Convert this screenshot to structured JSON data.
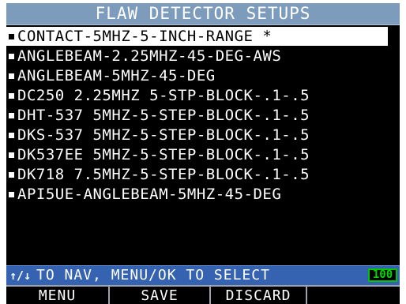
{
  "title": "FLAW DETECTOR SETUPS",
  "setups": [
    {
      "label": "CONTACT-5MHZ-5-INCH-RANGE  *",
      "selected": true
    },
    {
      "label": "ANGLEBEAM-2.25MHZ-45-DEG-AWS",
      "selected": false
    },
    {
      "label": "ANGLEBEAM-5MHZ-45-DEG",
      "selected": false
    },
    {
      "label": "DC250 2.25MHZ 5-STP-BLOCK-.1-.5",
      "selected": false
    },
    {
      "label": "DHT-537 5MHZ-5-STEP-BLOCK-.1-.5",
      "selected": false
    },
    {
      "label": "DKS-537 5MHZ-5-STEP-BLOCK-.1-.5",
      "selected": false
    },
    {
      "label": "DK537EE 5MHZ-5-STEP-BLOCK-.1-.5",
      "selected": false
    },
    {
      "label": "DK718 7.5MHZ-5-STEP-BLOCK-.1-.5",
      "selected": false
    },
    {
      "label": "API5UE-ANGLEBEAM-5MHZ-45-DEG",
      "selected": false
    }
  ],
  "status": {
    "nav_arrows": "↑/↓",
    "text": "TO NAV, MENU/OK TO SELECT",
    "battery": "100"
  },
  "softkeys": {
    "menu": "MENU",
    "save": "SAVE",
    "discard": "DISCARD",
    "blank": ""
  },
  "colors": {
    "title_bar": "#7d9cbc",
    "status_bar": "#3563b1",
    "battery": "#00c400",
    "screen_bg": "#000000",
    "selected_row": "#ffffff"
  },
  "icons": {
    "nav": "up-down-arrows-icon",
    "battery": "battery-icon",
    "bullet": "bullet-square-icon"
  }
}
